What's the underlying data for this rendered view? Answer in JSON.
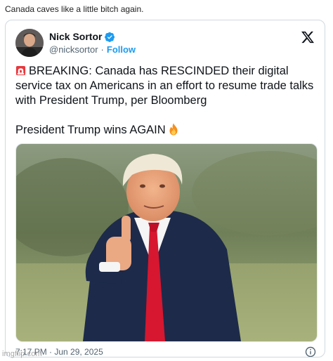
{
  "post": {
    "caption": "Canada caves like a little bitch again."
  },
  "tweet": {
    "author_name": "Nick Sortor",
    "handle": "@nicksortor",
    "separator": "·",
    "follow_label": "Follow",
    "text_paragraph_1": "BREAKING: Canada has RESCINDED their digital service tax on Americans in an effort to resume trade talks with President Trump, per Bloomberg",
    "text_paragraph_2": "President Trump wins AGAIN",
    "timestamp": "7:17 PM · Jun 29, 2025",
    "emoji_1": "police-car-light-icon",
    "emoji_2": "fire-icon",
    "verified_color": "#1d9bf0"
  },
  "watermark": {
    "text": "imgflip.com"
  },
  "colors": {
    "link": "#1d9bf0",
    "text": "#0f1419",
    "muted": "#536471",
    "border": "#cfd9de"
  }
}
